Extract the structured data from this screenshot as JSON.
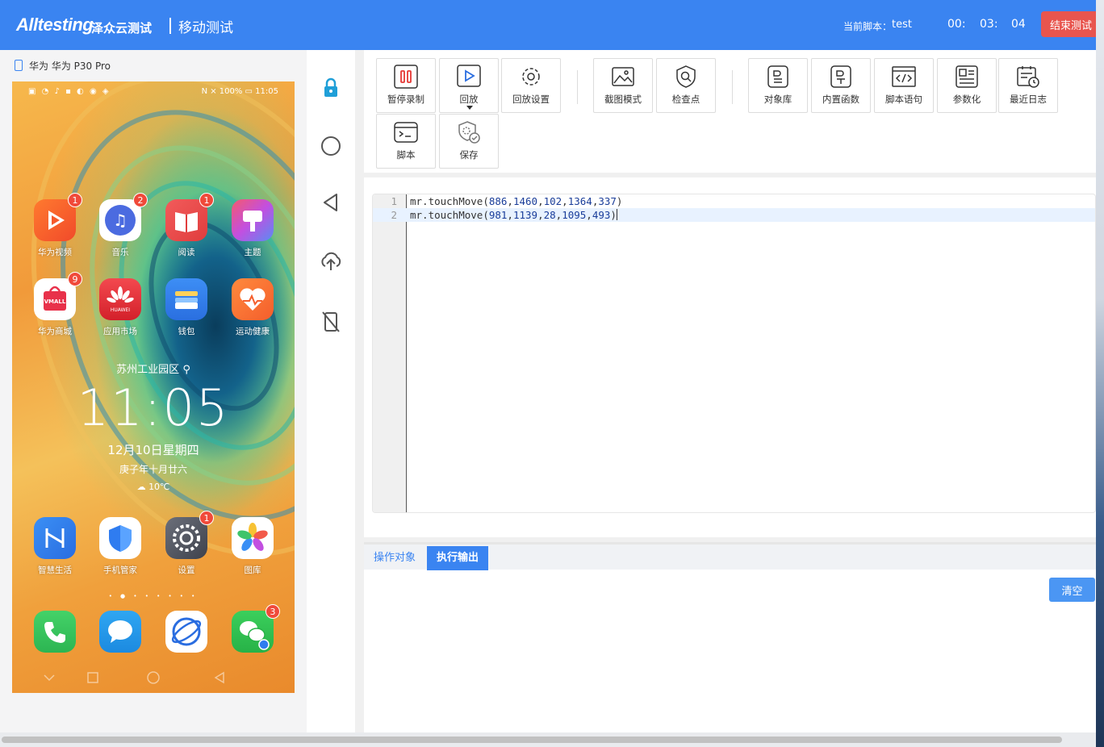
{
  "header": {
    "logo_text": "Alltesting",
    "logo_cn": "泽众云测试",
    "module_title": "移动测试",
    "current_script_label": "当前脚本：",
    "current_script_name": "test",
    "timer": {
      "hours": "00:",
      "minutes": "03:",
      "seconds": "04"
    },
    "stop_button": "结束测试",
    "colors": {
      "header_bg": "#3a84f1",
      "stop_bg": "#e8554e"
    }
  },
  "device": {
    "title": "华为 华为 P30 Pro",
    "status_left": "▣ ◔ ♪ ▪ ◐ ◉ ◈",
    "status_right": "N ⨯ 100% ▭ 11:05",
    "apps": [
      {
        "label": "华为视频",
        "icon": "video-icon",
        "badge": "1"
      },
      {
        "label": "音乐",
        "icon": "music-icon",
        "badge": "2"
      },
      {
        "label": "阅读",
        "icon": "book-icon",
        "badge": "1"
      },
      {
        "label": "主题",
        "icon": "brush-icon",
        "badge": ""
      },
      {
        "label": "华为商城",
        "icon": "vmall-icon",
        "badge": "9"
      },
      {
        "label": "应用市场",
        "icon": "huawei-icon",
        "badge": ""
      },
      {
        "label": "钱包",
        "icon": "wallet-icon",
        "badge": ""
      },
      {
        "label": "运动健康",
        "icon": "health-icon",
        "badge": ""
      },
      {
        "label": "智慧生活",
        "icon": "smart-life-icon",
        "badge": ""
      },
      {
        "label": "手机管家",
        "icon": "shield-icon",
        "badge": ""
      },
      {
        "label": "设置",
        "icon": "settings-icon",
        "badge": "1"
      },
      {
        "label": "图库",
        "icon": "gallery-icon",
        "badge": ""
      }
    ],
    "dock": [
      {
        "icon": "phone-icon",
        "badge": ""
      },
      {
        "icon": "message-icon",
        "badge": ""
      },
      {
        "icon": "browser-icon",
        "badge": ""
      },
      {
        "icon": "wechat-icon",
        "badge": "3"
      }
    ],
    "vmall_text": "VMALL",
    "huawei_text": "HUAWEI",
    "location": "苏州工业园区",
    "clock": "11:05",
    "date": "12月10日星期四",
    "lunar": "庚子年十月廿六",
    "weather": "10℃",
    "page_dots": "• ● • • • • • •"
  },
  "side_controls": [
    "lock-icon",
    "home-circle-icon",
    "back-triangle-icon",
    "upload-cloud-icon",
    "rotate-disabled-icon"
  ],
  "toolbar": {
    "pause_record": "暂停录制",
    "replay": "回放",
    "replay_settings": "回放设置",
    "screenshot_mode": "截图模式",
    "checkpoint": "检查点",
    "object_library": "对象库",
    "builtin_functions": "内置函数",
    "script_statement": "脚本语句",
    "parameterize": "参数化",
    "recent_logs": "最近日志",
    "script": "脚本",
    "save": "保存"
  },
  "editor": {
    "lines": [
      {
        "n": "1",
        "fn": "mr.touchMove",
        "args": [
          "886",
          "1460",
          "102",
          "1364",
          "337"
        ]
      },
      {
        "n": "2",
        "fn": "mr.touchMove",
        "args": [
          "981",
          "1139",
          "28",
          "1095",
          "493"
        ]
      }
    ]
  },
  "output": {
    "tab_objects": "操作对象",
    "tab_output": "执行输出",
    "clear_button": "清空"
  }
}
